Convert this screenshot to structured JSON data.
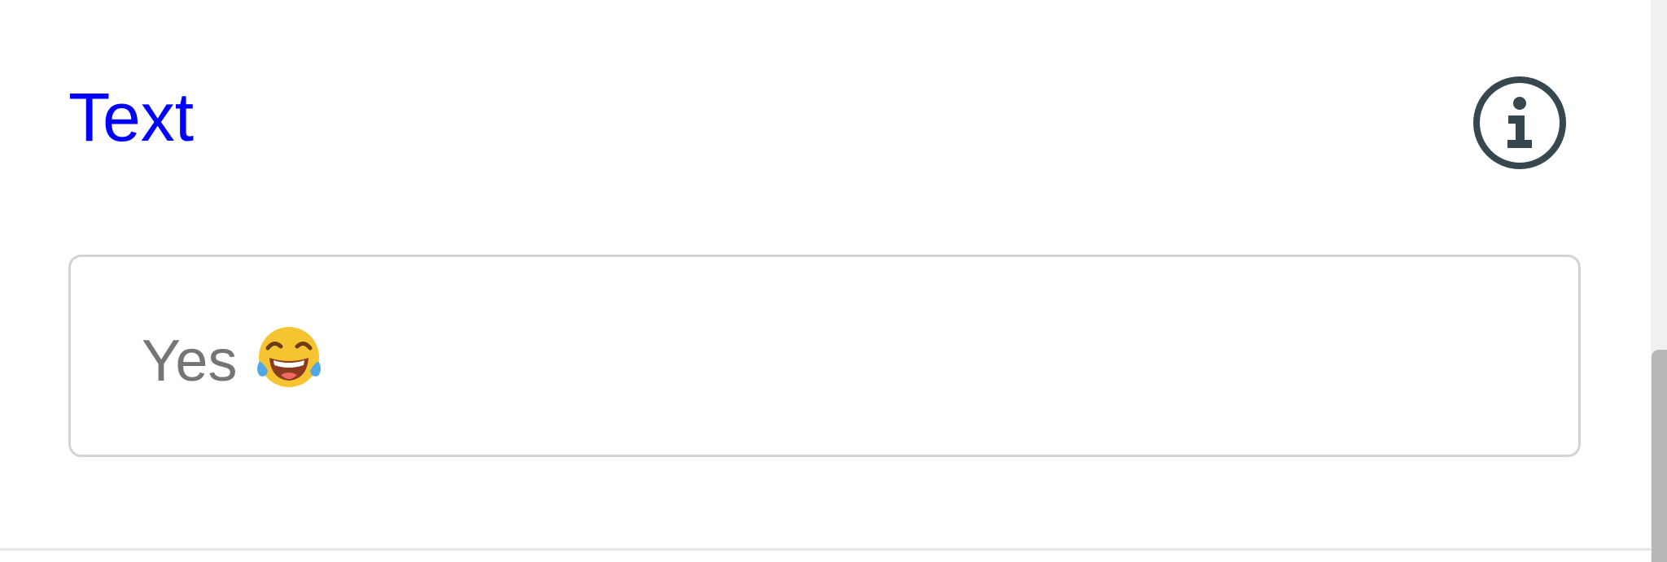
{
  "field": {
    "label": "Text",
    "value": "Yes",
    "value_emoji": "face-with-tears-of-joy",
    "info_icon": "info-circle-icon"
  },
  "colors": {
    "label": "#0000ff",
    "value_text": "#757575",
    "field_border": "#d3d3d3",
    "icon": "#37474f",
    "scrollbar_thumb": "#b8b8b8"
  },
  "scrollbar": {
    "position_fraction": 1.0
  }
}
